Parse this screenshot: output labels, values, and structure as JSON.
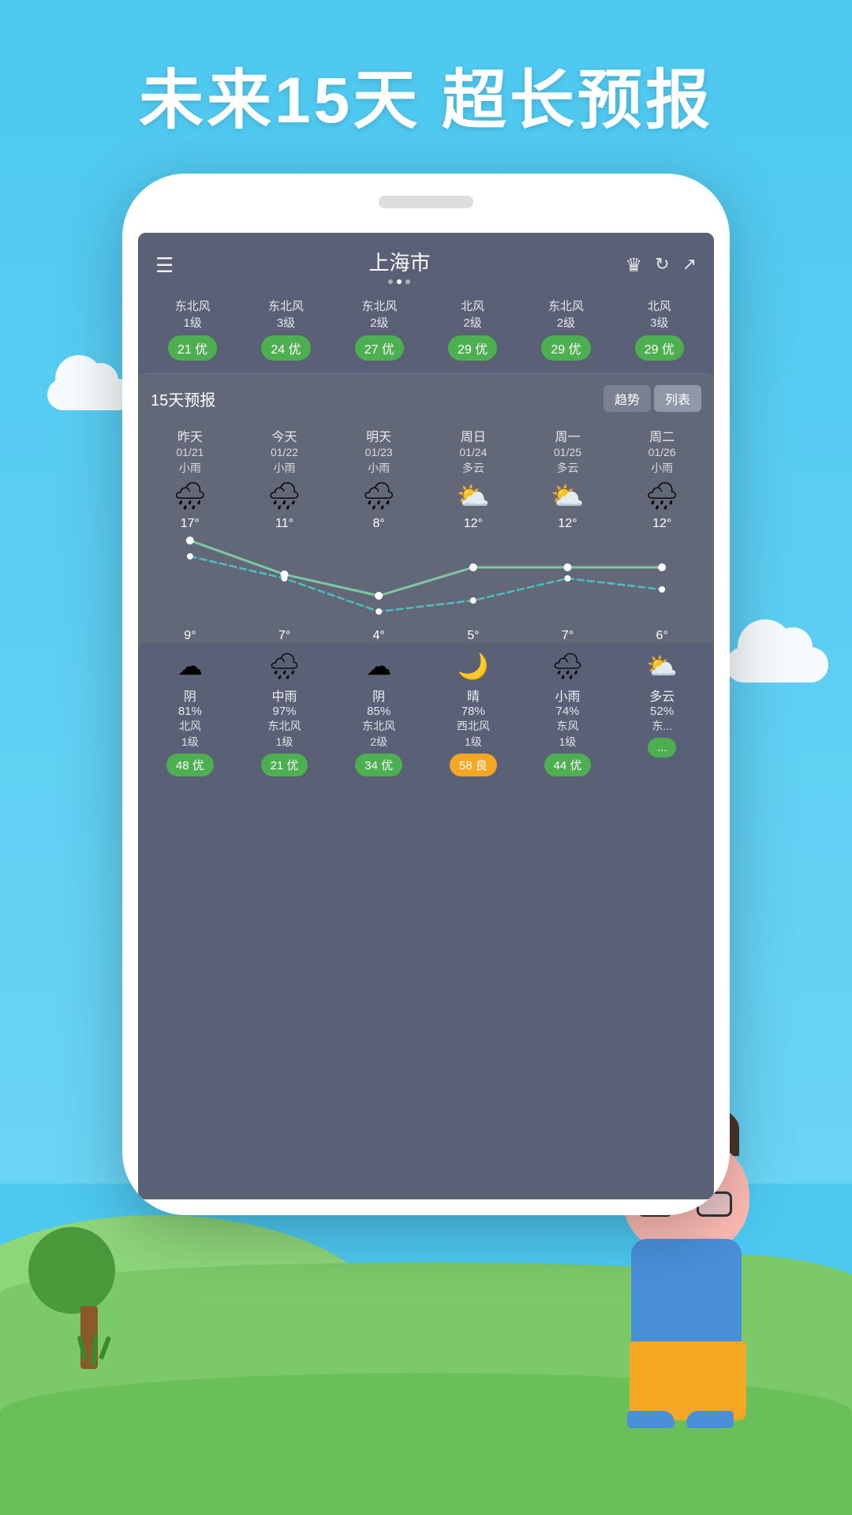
{
  "page": {
    "title": "未来15天 超长预报",
    "background_color": "#4DC8F0"
  },
  "phone": {
    "city": "上海市",
    "dots": [
      false,
      true,
      false
    ]
  },
  "aq_row": {
    "items": [
      {
        "wind": "东北风\n1级",
        "badge": "21 优",
        "badge_type": "you"
      },
      {
        "wind": "东北风\n3级",
        "badge": "24 优",
        "badge_type": "you"
      },
      {
        "wind": "东北风\n2级",
        "badge": "27 优",
        "badge_type": "you"
      },
      {
        "wind": "北风\n2级",
        "badge": "29 优",
        "badge_type": "you"
      },
      {
        "wind": "东北风\n2级",
        "badge": "29 优",
        "badge_type": "you"
      },
      {
        "wind": "北风\n3级",
        "badge": "29 优",
        "badge_type": "you"
      }
    ]
  },
  "forecast": {
    "title": "15天预报",
    "tab_trend": "趋势",
    "tab_list": "列表",
    "days": [
      {
        "name": "昨天",
        "date": "01/21",
        "weather": "小雨",
        "icon": "🌧",
        "high": "17°",
        "low": "9°"
      },
      {
        "name": "今天",
        "date": "01/22",
        "weather": "小雨",
        "icon": "🌧",
        "high": "11°",
        "low": "7°"
      },
      {
        "name": "明天",
        "date": "01/23",
        "weather": "小雨",
        "icon": "🌧",
        "high": "8°",
        "low": "4°"
      },
      {
        "name": "周日",
        "date": "01/24",
        "weather": "多云",
        "icon": "⛅",
        "high": "12°",
        "low": "5°"
      },
      {
        "name": "周一",
        "date": "01/25",
        "weather": "多云",
        "icon": "⛅",
        "high": "12°",
        "low": "7°"
      },
      {
        "name": "周二",
        "date": "01/26",
        "weather": "小雨",
        "icon": "🌧",
        "high": "12°",
        "low": "6°"
      }
    ]
  },
  "bottom_details": {
    "items": [
      {
        "icon": "☁",
        "condition": "阴",
        "humidity": "81%",
        "wind": "北风\n1级",
        "badge": "48 优",
        "badge_type": "you"
      },
      {
        "icon": "🌧",
        "condition": "中雨",
        "humidity": "97%",
        "wind": "东北风\n1级",
        "badge": "21 优",
        "badge_type": "you"
      },
      {
        "icon": "☁",
        "condition": "阴",
        "humidity": "85%",
        "wind": "东北风\n2级",
        "badge": "34 优",
        "badge_type": "you"
      },
      {
        "icon": "🌙",
        "condition": "晴",
        "humidity": "78%",
        "wind": "西北风\n1级",
        "badge": "58 良",
        "badge_type": "liang"
      },
      {
        "icon": "🌧",
        "condition": "小雨",
        "humidity": "74%",
        "wind": "东风\n1级",
        "badge": "44 优",
        "badge_type": "you"
      },
      {
        "icon": "⛅",
        "condition": "多云",
        "humidity": "52%",
        "wind": "东...",
        "badge": "...",
        "badge_type": "you"
      }
    ]
  }
}
